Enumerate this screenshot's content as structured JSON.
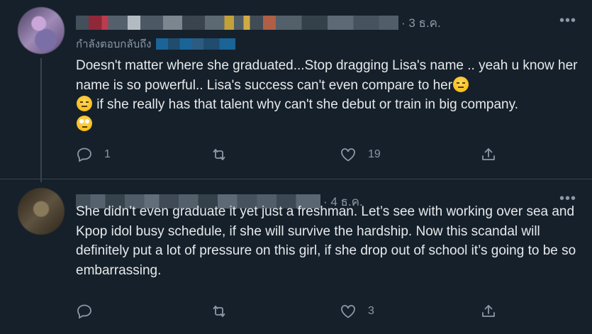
{
  "tweets": [
    {
      "time": "· 3 ธ.ค.",
      "reply_prefix": "กำลังตอบกลับถึง",
      "text_parts": [
        "Doesn't matter where she graduated...Stop dragging Lisa's name .. yeah u know her name is so powerful.. Lisa's success can't even compare to her",
        " if she really has that talent why can't she debut or train in big company. "
      ],
      "emoji_1": "expressionless-face-emoji",
      "emoji_2": "expressionless-face-emoji",
      "emoji_3": "eye-roll-emoji",
      "replies": "1",
      "retweets": "",
      "likes": "19"
    },
    {
      "time": "· 4 ธ.ค.",
      "text": "She didn’t even graduate it yet just a freshman. Let’s see with working over sea and Kpop idol busy schedule, if she will survive the hardship. Now this scandal will definitely put a lot of pressure on this girl, if she drop out of school it’s going to be so embarrassing.",
      "replies": "",
      "retweets": "",
      "likes": "3"
    }
  ],
  "more_label": "•••",
  "colors": {
    "background": "#15202b",
    "text": "#e7e9ea",
    "secondary": "#8b98a5",
    "divider": "#38444d"
  },
  "icons": [
    "reply-icon",
    "retweet-icon",
    "like-icon",
    "share-icon",
    "more-icon"
  ]
}
